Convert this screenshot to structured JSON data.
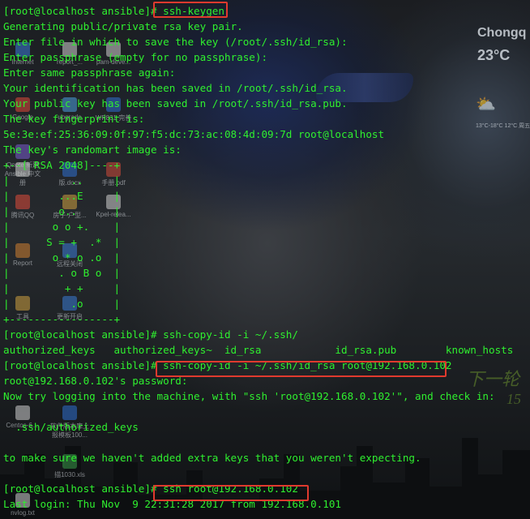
{
  "weather": {
    "city": "Chongq",
    "temperature": "23°C",
    "forecast": "13°C-18°C 12°C\n   周五"
  },
  "desktop_icons": [
    {
      "label": "Internet",
      "color": "#3b7bd6"
    },
    {
      "label": "report_...",
      "color": "#d0d0d0"
    },
    {
      "label": "pam-deve...",
      "color": "#d0d0d0"
    },
    {
      "label": "Google",
      "color": "#e04a3a"
    },
    {
      "label": "upgrade",
      "color": "#4aa0e0"
    },
    {
      "label": "WP831 完善",
      "color": "#2f6fd0"
    },
    {
      "label": "Qnote 新建 Ansible 中文",
      "color": "#7a5cd0"
    },
    {
      "label": "册",
      "color": "#d0d0d0"
    },
    {
      "label": "版.docx",
      "color": "#2f6fd0"
    },
    {
      "label": "手册.pdf",
      "color": "#d04a3a"
    },
    {
      "label": "腾讯QQ",
      "color": "#e04a3a"
    },
    {
      "label": "房子-户型...",
      "color": "#d0a040"
    },
    {
      "label": "Kpel-relea...",
      "color": "#d0d0d0"
    },
    {
      "label": "Report",
      "color": "#d08030"
    },
    {
      "label": "远程关闭",
      "color": "#3b7bd6"
    },
    {
      "label": "工具",
      "color": "#d0a040"
    },
    {
      "label": "更新开启",
      "color": "#3b7bd6"
    },
    {
      "label": "Centos-6....",
      "color": "#d0d0d0"
    },
    {
      "label": "软件版本库上\n报模板100...",
      "color": "#2f6fd0"
    },
    {
      "label": "描1030.xls",
      "color": "#3a9a4a"
    },
    {
      "label": "nvlog.txt",
      "color": "#d0d0d0"
    }
  ],
  "wallpaper_text": {
    "slogan": "下一轮",
    "slogan2": "15"
  },
  "terminal": {
    "lines": [
      "[root@localhost ansible]# ssh-keygen",
      "Generating public/private rsa key pair.",
      "Enter file in which to save the key (/root/.ssh/id_rsa):",
      "Enter passphrase (empty for no passphrase):",
      "Enter same passphrase again:",
      "Your identification has been saved in /root/.ssh/id_rsa.",
      "Your public key has been saved in /root/.ssh/id_rsa.pub.",
      "The key fingerprint is:",
      "5e:3e:ef:25:36:09:0f:97:f5:dc:73:ac:08:4d:09:7d root@localhost",
      "The key's randomart image is:",
      "+--[ RSA 2048]----+",
      "|          ..     |",
      "|        ...E     |",
      "|        o..      |",
      "|       o o +.    |",
      "|      S = +  .*  |",
      "|       o * o .o  |",
      "|        . o B o  |",
      "|         + +     |",
      "|          .o     |",
      "+-----------------+",
      "[root@localhost ansible]# ssh-copy-id -i ~/.ssh/",
      "authorized_keys   authorized_keys~  id_rsa            id_rsa.pub        known_hosts",
      "[root@localhost ansible]# ssh-copy-id -i ~/.ssh/id_rsa root@192.168.0.102",
      "root@192.168.0.102's password:",
      "Now try logging into the machine, with \"ssh 'root@192.168.0.102'\", and check in:",
      "",
      "  .ssh/authorized_keys",
      "",
      "to make sure we haven't added extra keys that you weren't expecting.",
      "",
      "[root@localhost ansible]# ssh root@192.168.0.102",
      "Last login: Thu Nov  9 22:31:28 2017 from 192.168.0.101"
    ],
    "text_color": "#2ff02f",
    "highlight_color": "#e03a2e"
  }
}
